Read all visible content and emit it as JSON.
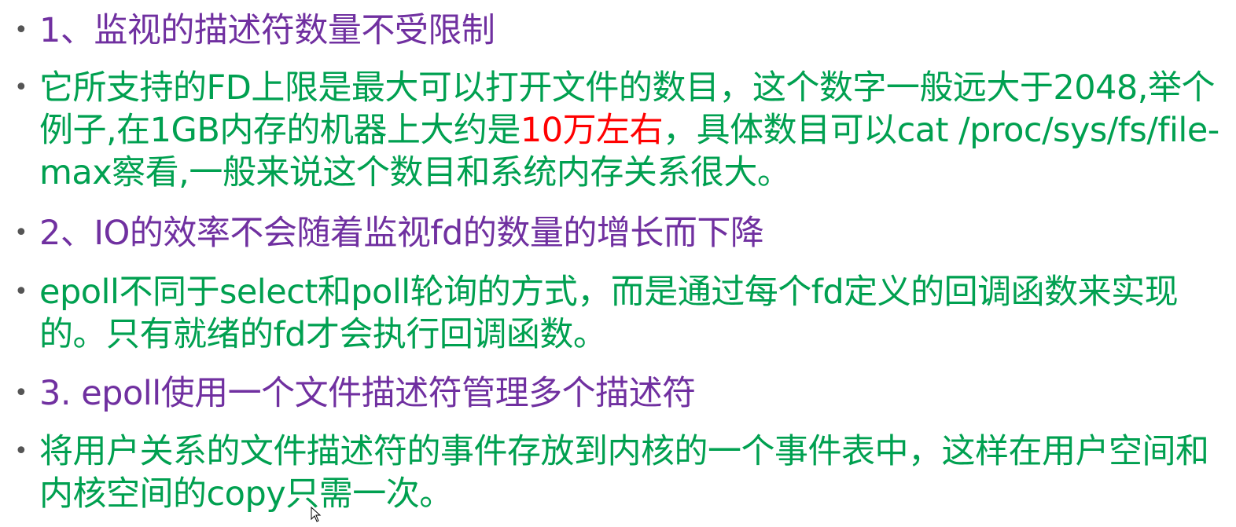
{
  "slide": {
    "bullet_symbol": "•",
    "items": [
      {
        "text": "1、监视的描述符数量不受限制",
        "color": "#7030a0"
      },
      {
        "text_before": "它所支持的FD上限是最大可以打开文件的数目，这个数字一般远大于2048,举个例子,在1GB内存的机器上大约是",
        "highlight": "10万左右",
        "text_after": "，具体数目可以cat /proc/sys/fs/file-max察看,一般来说这个数目和系统内存关系很大。",
        "color": "#00a050",
        "highlight_color": "#ff0000"
      },
      {
        "text": "2、IO的效率不会随着监视fd的数量的增长而下降",
        "color": "#7030a0"
      },
      {
        "text": "epoll不同于select和poll轮询的方式，而是通过每个fd定义的回调函数来实现的。只有就绪的fd才会执行回调函数。",
        "color": "#00a050"
      },
      {
        "text": "3. epoll使用一个文件描述符管理多个描述符",
        "color": "#7030a0"
      },
      {
        "text": "将用户关系的文件描述符的事件存放到内核的一个事件表中，这样在用户空间和内核空间的copy只需一次。",
        "color": "#00a050"
      }
    ]
  },
  "cursor": {
    "icon": "mouse-pointer-icon"
  }
}
